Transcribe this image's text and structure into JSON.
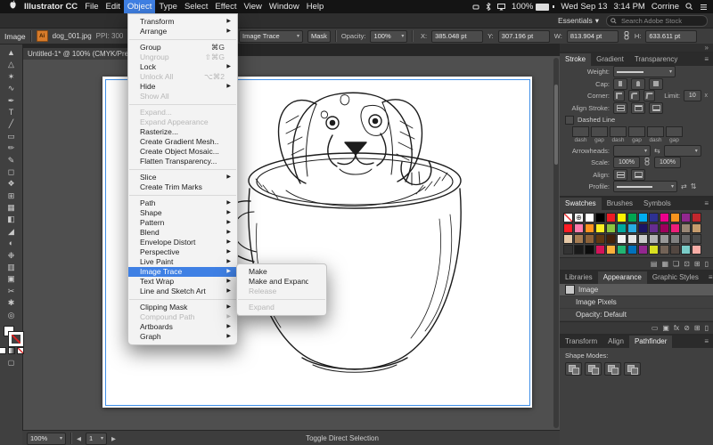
{
  "icons": {
    "caret_down": "▾",
    "submenu_arrow": "▶",
    "panel_menu": "≡",
    "collapse": "»",
    "prev": "◀",
    "next": "▶",
    "swap": "⇆",
    "flip_h": "⇄",
    "flip_v": "⇅"
  },
  "menubar": {
    "items": [
      {
        "label": "Illustrator CC",
        "bold": true
      },
      {
        "label": "File"
      },
      {
        "label": "Edit"
      },
      {
        "label": "Object",
        "active": true
      },
      {
        "label": "Type"
      },
      {
        "label": "Select"
      },
      {
        "label": "Effect"
      },
      {
        "label": "View"
      },
      {
        "label": "Window"
      },
      {
        "label": "Help"
      }
    ],
    "status": {
      "battery_pct": "100%",
      "date": "Wed Sep 13",
      "time": "3:14 PM",
      "user": "Corrine"
    }
  },
  "object_menu": {
    "items": [
      {
        "label": "Transform",
        "submenu": true
      },
      {
        "label": "Arrange",
        "submenu": true
      },
      {
        "sep": true
      },
      {
        "label": "Group",
        "shortcut": "⌘G"
      },
      {
        "label": "Ungroup",
        "shortcut": "⇧⌘G",
        "disabled": true
      },
      {
        "label": "Lock",
        "submenu": true
      },
      {
        "label": "Unlock All",
        "shortcut": "⌥⌘2",
        "disabled": true
      },
      {
        "label": "Hide",
        "submenu": true
      },
      {
        "label": "Show All",
        "disabled": true
      },
      {
        "sep": true
      },
      {
        "label": "Expand...",
        "disabled": true
      },
      {
        "label": "Expand Appearance",
        "disabled": true
      },
      {
        "label": "Rasterize..."
      },
      {
        "label": "Create Gradient Mesh..."
      },
      {
        "label": "Create Object Mosaic..."
      },
      {
        "label": "Flatten Transparency..."
      },
      {
        "sep": true
      },
      {
        "label": "Slice",
        "submenu": true
      },
      {
        "label": "Create Trim Marks"
      },
      {
        "sep": true
      },
      {
        "label": "Path",
        "submenu": true
      },
      {
        "label": "Shape",
        "submenu": true
      },
      {
        "label": "Pattern",
        "submenu": true
      },
      {
        "label": "Blend",
        "submenu": true
      },
      {
        "label": "Envelope Distort",
        "submenu": true
      },
      {
        "label": "Perspective",
        "submenu": true
      },
      {
        "label": "Live Paint",
        "submenu": true
      },
      {
        "label": "Image Trace",
        "submenu": true,
        "highlighted": true
      },
      {
        "label": "Text Wrap",
        "submenu": true
      },
      {
        "label": "Line and Sketch Art",
        "submenu": true
      },
      {
        "sep": true
      },
      {
        "label": "Clipping Mask",
        "submenu": true
      },
      {
        "label": "Compound Path",
        "submenu": true,
        "disabled": true
      },
      {
        "label": "Artboards",
        "submenu": true
      },
      {
        "label": "Graph",
        "submenu": true
      }
    ]
  },
  "image_trace_submenu": {
    "items": [
      {
        "label": "Make"
      },
      {
        "label": "Make and Expand"
      },
      {
        "label": "Release",
        "disabled": true
      },
      {
        "sep": true
      },
      {
        "label": "Expand",
        "disabled": true
      }
    ]
  },
  "appbar": {
    "workspace": "Essentials",
    "search_placeholder": "Search Adobe Stock"
  },
  "control_bar": {
    "selection_label": "Image",
    "file_icon_text": "Ai",
    "file_name": "dog_001.jpg",
    "ppi": "PPI: 300",
    "image_trace_button": "Image Trace",
    "mask_button": "Mask",
    "opacity_label": "Opacity:",
    "opacity_value": "100%",
    "x_label": "X:",
    "x_value": "385.048 pt",
    "y_label": "Y:",
    "y_value": "307.196 pt",
    "w_label": "W:",
    "w_value": "813.904 pt",
    "h_label": "H:",
    "h_value": "633.611 pt"
  },
  "document_tab": {
    "title": "Untitled-1* @ 100% (CMYK/Preview)",
    "close": "×"
  },
  "toolbar": {
    "tools": [
      {
        "name": "selection-tool",
        "glyph": "▲"
      },
      {
        "name": "direct-selection-tool",
        "glyph": "△"
      },
      {
        "name": "magic-wand-tool",
        "glyph": "✶"
      },
      {
        "name": "lasso-tool",
        "glyph": "∿"
      },
      {
        "name": "pen-tool",
        "glyph": "✒"
      },
      {
        "name": "type-tool",
        "glyph": "T"
      },
      {
        "name": "line-segment-tool",
        "glyph": "╱"
      },
      {
        "name": "rectangle-tool",
        "glyph": "▭"
      },
      {
        "name": "paintbrush-tool",
        "glyph": "✏"
      },
      {
        "name": "pencil-tool",
        "glyph": "✎"
      },
      {
        "name": "free-transform-tool",
        "glyph": "◻"
      },
      {
        "name": "shape-builder-tool",
        "glyph": "❖"
      },
      {
        "name": "perspective-grid-tool",
        "glyph": "⊞"
      },
      {
        "name": "mesh-tool",
        "glyph": "▦"
      },
      {
        "name": "gradient-tool",
        "glyph": "◧"
      },
      {
        "name": "eyedropper-tool",
        "glyph": "◢"
      },
      {
        "name": "blend-tool",
        "glyph": "◐"
      },
      {
        "name": "symbol-sprayer-tool",
        "glyph": "❉"
      },
      {
        "name": "column-graph-tool",
        "glyph": "▥"
      },
      {
        "name": "artboard-tool",
        "glyph": "▣"
      },
      {
        "name": "slice-tool",
        "glyph": "✂"
      },
      {
        "name": "hand-tool",
        "glyph": "✱"
      },
      {
        "name": "zoom-tool",
        "glyph": "◎"
      }
    ]
  },
  "stroke_panel": {
    "tabs": [
      {
        "label": "Stroke",
        "active": true
      },
      {
        "label": "Gradient"
      },
      {
        "label": "Transparency"
      }
    ],
    "weight_label": "Weight:",
    "cap_label": "Cap:",
    "corner_label": "Corner:",
    "limit_label": "Limit:",
    "limit_value": "10",
    "limit_suffix": "x",
    "align_stroke_label": "Align Stroke:",
    "dashed_line_label": "Dashed Line",
    "dash_labels": [
      "dash",
      "gap",
      "dash",
      "gap",
      "dash",
      "gap"
    ],
    "arrowheads_label": "Arrowheads:",
    "scale_label": "Scale:",
    "scale_value_1": "100%",
    "scale_value_2": "100%",
    "align_label": "Align:",
    "profile_label": "Profile:"
  },
  "swatches_panel": {
    "tabs": [
      {
        "label": "Swatches",
        "active": true
      },
      {
        "label": "Brushes"
      },
      {
        "label": "Symbols"
      }
    ],
    "swatches": [
      "none",
      "registration",
      "#ffffff",
      "#000000",
      "#ed1c24",
      "#fff200",
      "#00a651",
      "#00aeef",
      "#2e3192",
      "#ec008c",
      "#f7941e",
      "#92278f",
      "#c1272d",
      "#ff1d25",
      "#ff7bac",
      "#ff931e",
      "#fcee21",
      "#8cc63f",
      "#00a99d",
      "#29abe2",
      "#1b1464",
      "#662d91",
      "#9e005d",
      "#ed1e79",
      "#998675",
      "#c69c6d",
      "#e6c9a8",
      "#a67c52",
      "#8c6239",
      "#603913",
      "#42210b",
      "#f2f2f2",
      "#e6e6e6",
      "#cccccc",
      "#b3b3b3",
      "#999999",
      "#808080",
      "#666666",
      "#4d4d4d",
      "#333333",
      "#1a1a1a",
      "#0d0d0d",
      "#d4145a",
      "#fbb03b",
      "#22b573",
      "#0071bc",
      "#93278f",
      "#d9e021",
      "#736357",
      "#534741",
      "#7accc8",
      "#f9ada6"
    ],
    "footer_icons": [
      {
        "name": "swatch-libraries-icon",
        "glyph": "▤"
      },
      {
        "name": "show-swatch-kinds-icon",
        "glyph": "▦"
      },
      {
        "name": "swatch-options-icon",
        "glyph": "❏"
      },
      {
        "name": "new-color-group-icon",
        "glyph": "⊡"
      },
      {
        "name": "new-swatch-icon",
        "glyph": "⊞"
      },
      {
        "name": "delete-swatch-icon",
        "glyph": "▯"
      }
    ]
  },
  "appearance_panel": {
    "tabs": [
      {
        "label": "Libraries"
      },
      {
        "label": "Appearance",
        "active": true
      },
      {
        "label": "Graphic Styles"
      }
    ],
    "rows": [
      {
        "label": "Image",
        "selected": true,
        "thumb": true
      },
      {
        "label": "Image Pixels",
        "indent": true
      },
      {
        "label": "Opacity: Default",
        "indent": true
      }
    ],
    "footer_icons": [
      {
        "name": "new-stroke-icon",
        "glyph": "▭"
      },
      {
        "name": "new-fill-icon",
        "glyph": "▣"
      },
      {
        "name": "add-effect-icon",
        "glyph": "fx"
      },
      {
        "name": "clear-appearance-icon",
        "glyph": "⊘"
      },
      {
        "name": "duplicate-item-icon",
        "glyph": "⊞"
      },
      {
        "name": "delete-item-icon",
        "glyph": "▯"
      }
    ]
  },
  "pathfinder_panel": {
    "tabs": [
      {
        "label": "Transform"
      },
      {
        "label": "Align"
      },
      {
        "label": "Pathfinder",
        "active": true
      }
    ],
    "shape_modes_label": "Shape Modes:"
  },
  "statusbar": {
    "zoom": "100%",
    "artboard_number": "1",
    "status_text": "Toggle Direct Selection"
  }
}
